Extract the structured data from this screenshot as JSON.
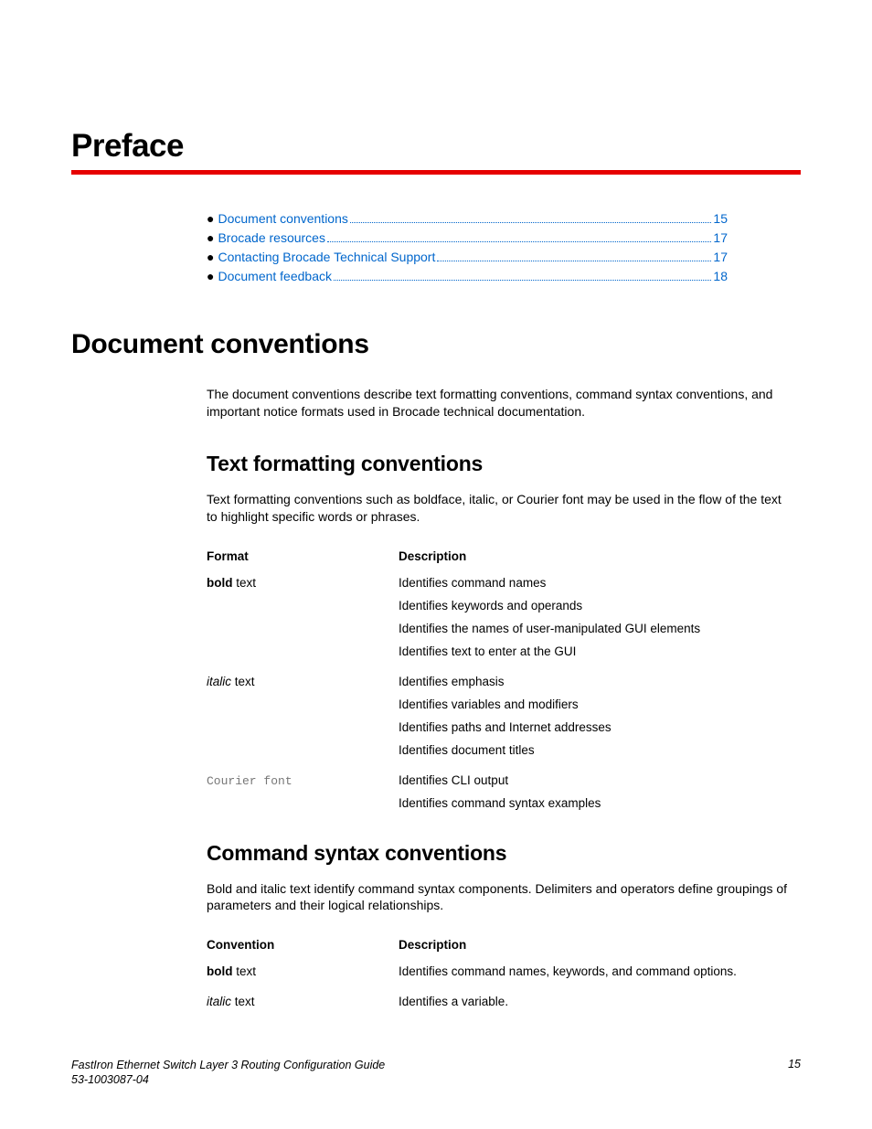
{
  "chapter": {
    "title": "Preface"
  },
  "toc": {
    "items": [
      {
        "label": "Document conventions",
        "page": "15"
      },
      {
        "label": "Brocade resources",
        "page": "17"
      },
      {
        "label": "Contacting Brocade Technical Support",
        "page": "17"
      },
      {
        "label": "Document feedback",
        "page": "18"
      }
    ]
  },
  "section1": {
    "heading": "Document conventions",
    "intro": "The document conventions describe text formatting conventions, command syntax conventions, and important notice formats used in Brocade technical documentation."
  },
  "sub1": {
    "heading": "Text formatting conventions",
    "intro": "Text formatting conventions such as boldface, italic, or Courier font may be used in the flow of the text to highlight specific words or phrases.",
    "table": {
      "head": {
        "c1": "Format",
        "c2": "Description"
      },
      "rows": [
        {
          "format_strong": "bold",
          "format_rest": " text",
          "lines": [
            "Identifies command names",
            "Identifies keywords and operands",
            "Identifies the names of user-manipulated GUI elements",
            "Identifies text to enter at the GUI"
          ]
        },
        {
          "format_em": "italic",
          "format_rest": " text",
          "lines": [
            "Identifies emphasis",
            "Identifies variables and modifiers",
            "Identifies paths and Internet addresses",
            "Identifies document titles"
          ]
        },
        {
          "format_code": "Courier font",
          "lines": [
            "Identifies CLI output",
            "Identifies command syntax examples"
          ]
        }
      ]
    }
  },
  "sub2": {
    "heading": "Command syntax conventions",
    "intro": "Bold and italic text identify command syntax components. Delimiters and operators define groupings of parameters and their logical relationships.",
    "table": {
      "head": {
        "c1": "Convention",
        "c2": "Description"
      },
      "rows": [
        {
          "format_strong": "bold",
          "format_rest": " text",
          "lines": [
            "Identifies command names, keywords, and command options."
          ]
        },
        {
          "format_em": "italic",
          "format_rest": " text",
          "lines": [
            "Identifies a variable."
          ]
        }
      ]
    }
  },
  "footer": {
    "title": "FastIron Ethernet Switch Layer 3 Routing Configuration Guide",
    "docnum": "53-1003087-04",
    "page": "15"
  }
}
